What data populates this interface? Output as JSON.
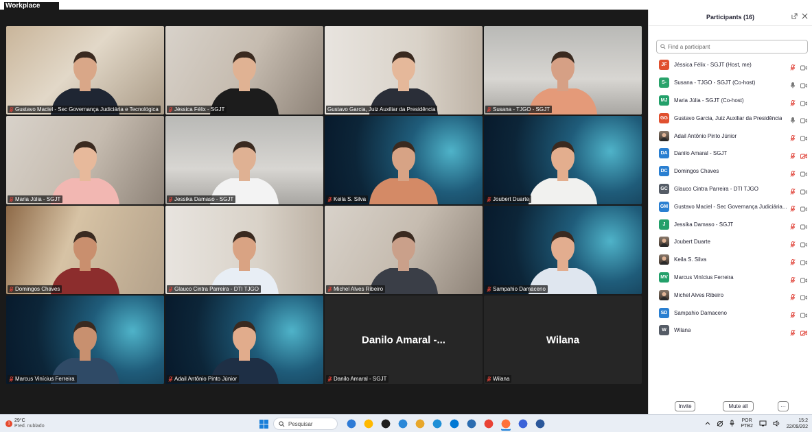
{
  "app": {
    "title": "Workplace"
  },
  "gallery": {
    "tiles": [
      {
        "name": "Gustavo Maciel - Sec Governança Judiciária e Tecnológica",
        "bg": "bg-office",
        "skin": "#d9a788",
        "shirt": "#1f2633",
        "mic_off": true
      },
      {
        "name": "Jéssica Félix - SGJT",
        "bg": "bg-office2",
        "skin": "#e0b293",
        "shirt": "#1c1c1c",
        "mic_off": true
      },
      {
        "name": "Gustavo Garcia, Juiz Auxiliar da Presidência",
        "bg": "bg-wall",
        "skin": "#e5b89a",
        "shirt": "#2a2e38",
        "mic_off": false
      },
      {
        "name": "Susana - TJGO - SGJT",
        "bg": "bg-gray",
        "skin": "#d6a085",
        "shirt": "#e49a79",
        "mic_off": true,
        "speaking": true
      },
      {
        "name": "Maria Júlia - SGJT",
        "bg": "bg-office2",
        "skin": "#e7b99b",
        "shirt": "#f2b7b2",
        "mic_off": true
      },
      {
        "name": "Jessika Damaso - SGJT",
        "bg": "bg-gray",
        "skin": "#dfb193",
        "shirt": "#f3f3f3",
        "mic_off": true
      },
      {
        "name": "Keila S. Silva",
        "bg": "bg-diamond",
        "skin": "#d7a385",
        "shirt": "#d48a66",
        "mic_off": true
      },
      {
        "name": "Joubert Duarte",
        "bg": "bg-diamond",
        "skin": "#e3ae8e",
        "shirt": "#f1f1ef",
        "mic_off": true
      },
      {
        "name": "Domingos Chaves",
        "bg": "bg-wood",
        "skin": "#c98f6e",
        "shirt": "#8c2d2d",
        "mic_off": true
      },
      {
        "name": "Glauco Cintra Parreira - DTI TJGO",
        "bg": "bg-wall",
        "skin": "#d9a383",
        "shirt": "#e8eef5",
        "mic_off": true
      },
      {
        "name": "Michel Alves Ribeiro",
        "bg": "bg-office2",
        "skin": "#caa08a",
        "shirt": "#3a3e47",
        "mic_off": true
      },
      {
        "name": "Sampahio Damaceno",
        "bg": "bg-diamond",
        "skin": "#e2ad8f",
        "shirt": "#dfe6ef",
        "mic_off": true
      },
      {
        "name": "Marcus Vinícius Ferreira",
        "bg": "bg-diamond",
        "skin": "#c8906f",
        "shirt": "#2f4a66",
        "mic_off": true
      },
      {
        "name": "Adail Antônio Pinto Júnior",
        "bg": "bg-diamond",
        "skin": "#e1ac8c",
        "shirt": "#1e2f45",
        "mic_off": true
      },
      {
        "name": "Danilo Amaral - SGJT",
        "bg": "bg-dark",
        "center": "Danilo Amaral -...",
        "mic_off": true
      },
      {
        "name": "Wilana",
        "bg": "bg-dark",
        "center": "Wilana",
        "mic_off": true
      }
    ]
  },
  "panel": {
    "title": "Participants (16)",
    "search_placeholder": "Find a participant",
    "participants": [
      {
        "initials": "JF",
        "color": "#e0502f",
        "name": "Jéssica Félix - SGJT (Host, me)",
        "mic": "off",
        "video": "on"
      },
      {
        "initials": "S-",
        "color": "#2aa36b",
        "name": "Susana - TJGO - SGJT (Co-host)",
        "mic": "on",
        "video": "on"
      },
      {
        "initials": "MJ",
        "color": "#23a06a",
        "name": "Maria Júlia - SGJT (Co-host)",
        "mic": "off",
        "video": "on"
      },
      {
        "initials": "GG",
        "color": "#e0502f",
        "name": "Gustavo Garcia, Juiz Auxiliar da Presidência",
        "mic": "on",
        "video": "on"
      },
      {
        "initials": "",
        "color": "#6b5a4c",
        "photo": true,
        "name": "Adail Antônio Pinto Júnior",
        "mic": "off",
        "video": "on"
      },
      {
        "initials": "DA",
        "color": "#2a7fd1",
        "name": "Danilo Amaral - SGJT",
        "mic": "off",
        "video": "off"
      },
      {
        "initials": "DC",
        "color": "#2a7fd1",
        "name": "Domingos Chaves",
        "mic": "off",
        "video": "on"
      },
      {
        "initials": "GC",
        "color": "#555c66",
        "name": "Glauco Cintra Parreira - DTI TJGO",
        "mic": "off",
        "video": "on"
      },
      {
        "initials": "GM",
        "color": "#2a7fd1",
        "name": "Gustavo Maciel - Sec Governança Judiciária...",
        "mic": "off",
        "video": "on"
      },
      {
        "initials": "J",
        "color": "#23a06a",
        "name": "Jessika Damaso - SGJT",
        "mic": "off",
        "video": "on"
      },
      {
        "initials": "",
        "color": "#6b5a4c",
        "photo": true,
        "name": "Joubert Duarte",
        "mic": "off",
        "video": "on"
      },
      {
        "initials": "",
        "color": "#8a6b5b",
        "photo": true,
        "name": "Keila S. Silva",
        "mic": "off",
        "video": "on"
      },
      {
        "initials": "MV",
        "color": "#23a06a",
        "name": "Marcus Vinícius Ferreira",
        "mic": "off",
        "video": "on"
      },
      {
        "initials": "",
        "color": "#7a6a5e",
        "photo": true,
        "name": "Michel Alves Ribeiro",
        "mic": "off",
        "video": "on"
      },
      {
        "initials": "SD",
        "color": "#2a7fd1",
        "name": "Sampahio Damaceno",
        "mic": "off",
        "video": "on"
      },
      {
        "initials": "W",
        "color": "#555c66",
        "name": "Wilana",
        "mic": "off",
        "video": "off"
      }
    ],
    "footer": {
      "invite_label": "Invite",
      "mute_all_label": "Mute all",
      "more_label": "···"
    }
  },
  "taskbar": {
    "weather_temp": "29°C",
    "weather_desc": "Pred. nublado",
    "search_label": "Pesquisar",
    "lang_top": "POR",
    "lang_bottom": "PTB2",
    "time": "15:2",
    "date": "22/09/202",
    "apps": [
      "#2e7bd6",
      "#ffb900",
      "#1e1e1e",
      "#2b88d8",
      "#e8a72a",
      "#1f8fd6",
      "#0078d4",
      "#2b6cb0",
      "#e94235",
      "#ff7139",
      "#3a62d9",
      "#2b579a"
    ]
  },
  "colors": {
    "accent": "#2fc56b",
    "mic_off": "#e0443a",
    "panel_text": "#232333"
  }
}
